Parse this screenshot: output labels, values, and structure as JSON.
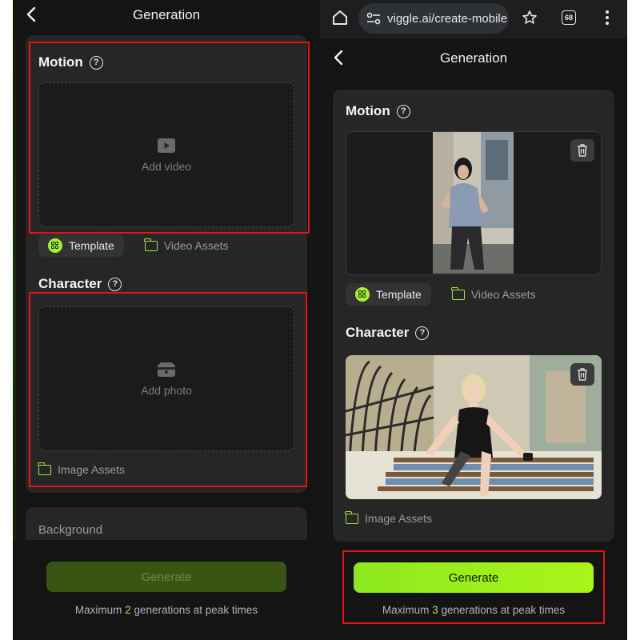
{
  "left": {
    "title": "Generation",
    "motion": {
      "title": "Motion",
      "help": "?",
      "dropzone_label": "Add video"
    },
    "motion_tabs": {
      "template": "Template",
      "video_assets": "Video Assets"
    },
    "character": {
      "title": "Character",
      "help": "?",
      "dropzone_label": "Add photo",
      "image_assets": "Image Assets"
    },
    "background": {
      "title": "Background"
    },
    "generate": {
      "label": "Generate",
      "note_prefix": "Maximum",
      "note_count": "2",
      "note_suffix": "generations at peak times"
    }
  },
  "right": {
    "browser": {
      "url": "viggle.ai/create-mobile",
      "tab_count": "68"
    },
    "title": "Generation",
    "motion": {
      "title": "Motion",
      "help": "?"
    },
    "motion_tabs": {
      "template": "Template",
      "video_assets": "Video Assets"
    },
    "character": {
      "title": "Character",
      "help": "?",
      "image_assets": "Image Assets"
    },
    "generate": {
      "label": "Generate",
      "note_prefix": "Maximum",
      "note_count": "3",
      "note_suffix": "generations at peak times"
    }
  },
  "colors": {
    "accent": "#a4f03a",
    "highlight_box": "#e01616",
    "background": "#141414",
    "card": "#262626"
  }
}
